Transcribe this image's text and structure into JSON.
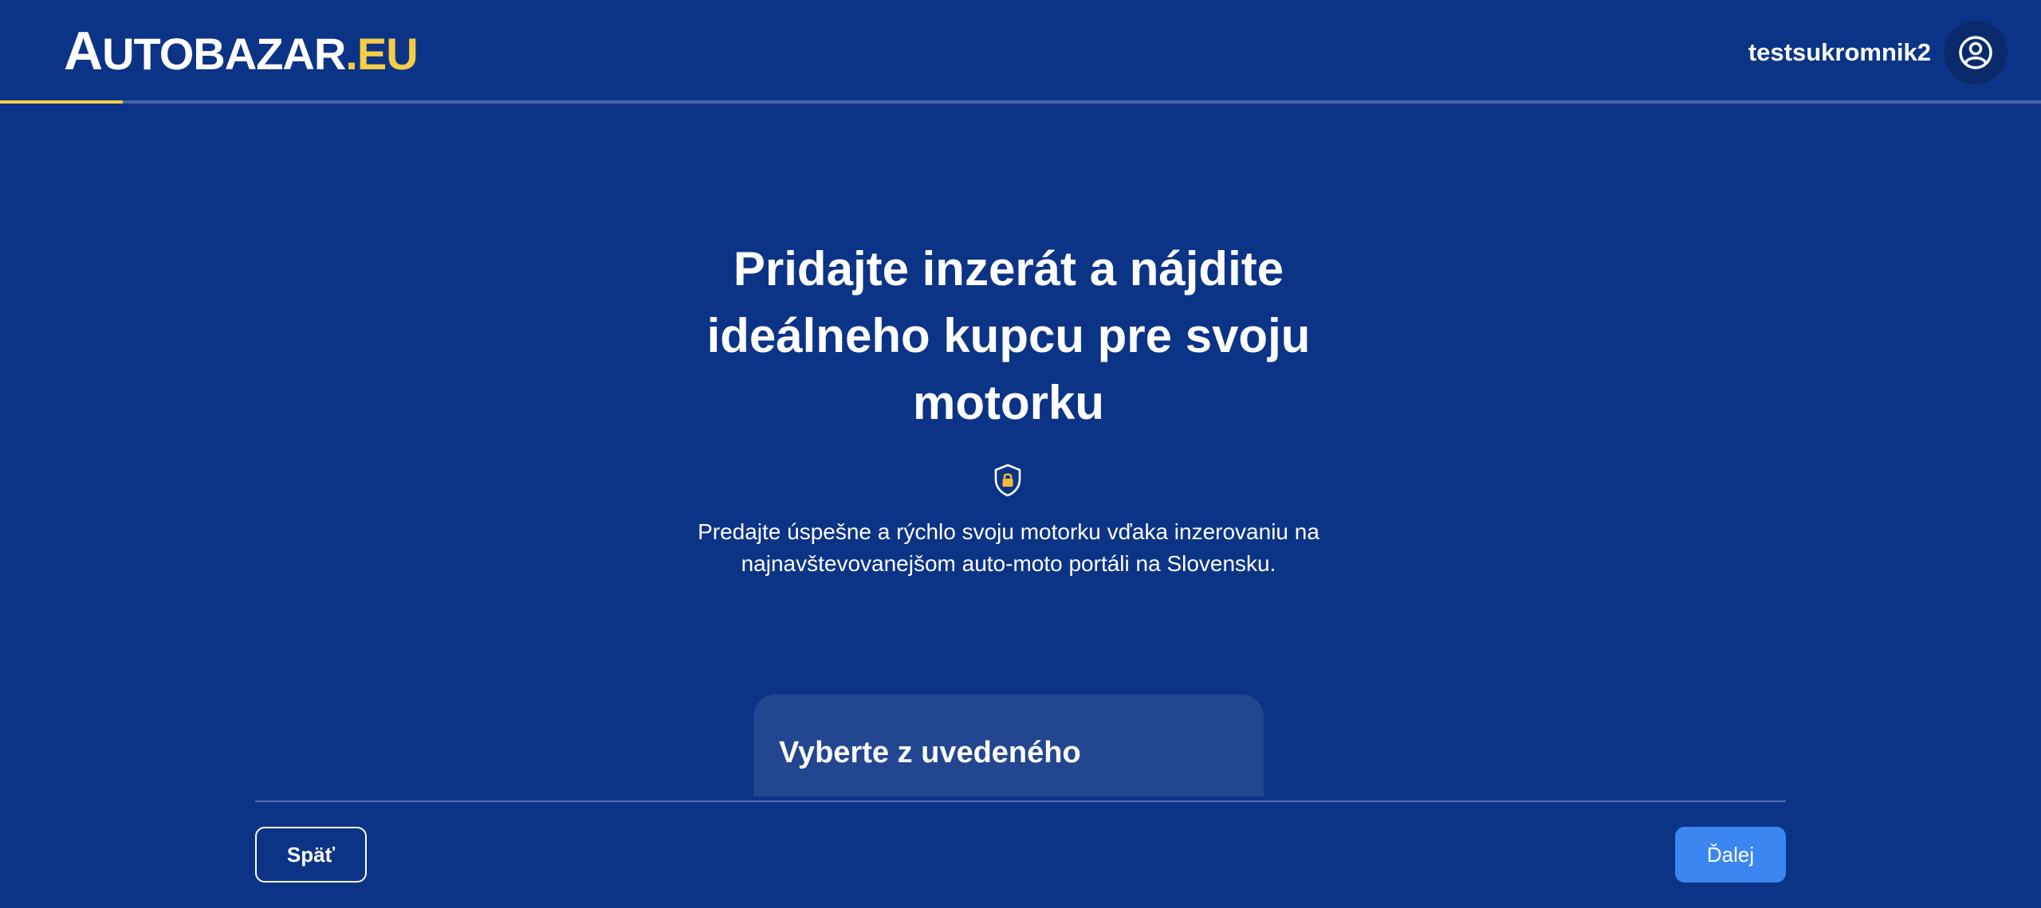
{
  "header": {
    "logo": {
      "first_letter": "A",
      "rest": "UTOBAZAR",
      "dot": ".",
      "suffix": "EU"
    },
    "username": "testsukromnik2",
    "avatar_icon": "user-circle-icon",
    "progress": 0.06
  },
  "hero": {
    "title": "Pridajte inzerát a nájdite ideálneho kupcu pre svoju motorku",
    "icon": "shield-lock-icon",
    "description": "Predajte úspešne a rýchlo svoju motorku vďaka inzerovaniu na najnavštevovanejšom auto-moto portáli na Slovensku."
  },
  "card": {
    "title": "Vyberte z uvedeného"
  },
  "footer": {
    "back_label": "Späť",
    "next_label": "Ďalej"
  },
  "colors": {
    "background": "#0c3486",
    "accent_yellow": "#f5cd47",
    "primary_button": "#3b86f0",
    "card": "#22468f"
  }
}
